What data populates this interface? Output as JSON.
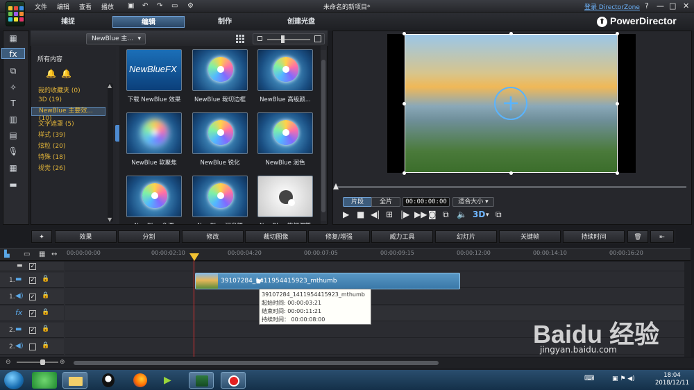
{
  "menu": {
    "file": "文件",
    "edit": "编辑",
    "view": "查看",
    "play": "播放"
  },
  "window_title": "未命名的新项目*",
  "login_link": "登录 DirectorZone",
  "window_buttons": {
    "help": "?",
    "minimize": "—",
    "maximize": "□",
    "close": "✕"
  },
  "modes": [
    {
      "label": "捕捉"
    },
    {
      "label": "编辑"
    },
    {
      "label": "制作"
    },
    {
      "label": "创建光盘"
    }
  ],
  "brand": "PowerDirector",
  "library": {
    "dropdown": "NewBlue 主...",
    "category_header": "所有内容",
    "categories": [
      {
        "label": "我的收藏夹 (0)"
      },
      {
        "label": "3D (19)"
      },
      {
        "label": "NewBlue 主要效... (10)"
      },
      {
        "label": "文字遮罩 (5)"
      },
      {
        "label": "样式 (39)"
      },
      {
        "label": "炫粒 (20)"
      },
      {
        "label": "特殊 (18)"
      },
      {
        "label": "视觉 (26)"
      }
    ],
    "thumbs": [
      {
        "label": "下载 NewBlue 效果",
        "overlay": "NewBlueFX"
      },
      {
        "label": "NewBlue 裁切边框"
      },
      {
        "label": "NewBlue 高级颜..."
      },
      {
        "label": "NewBlue 软聚焦"
      },
      {
        "label": "NewBlue 锐化"
      },
      {
        "label": "NewBlue 润色"
      },
      {
        "label": "NewBlue 色调"
      },
      {
        "label": "NewBlue 闪光耀"
      },
      {
        "label": "NewBlue 旋烟调整"
      }
    ]
  },
  "preview": {
    "mode_clip": "片段",
    "mode_movie": "全片",
    "timecode": "00:00:00:00",
    "fit": "适合大小",
    "threed": "3D"
  },
  "toolbar": [
    "效果",
    "分割",
    "修改",
    "裁切图像",
    "修复/增强",
    "威力工具",
    "幻灯片",
    "关键帧",
    "持续时间"
  ],
  "ruler": [
    "00:00:00:00",
    "00:00:02:10",
    "00:00:04:20",
    "00:00:07:05",
    "00:00:09:15",
    "00:00:12:00",
    "00:00:14:10",
    "00:00:16:20"
  ],
  "tracks": [
    {
      "num": "",
      "checked": true
    },
    {
      "num": "1.",
      "checked": true
    },
    {
      "num": "1.",
      "checked": true
    },
    {
      "num": "",
      "checked": true
    },
    {
      "num": "2.",
      "checked": true
    },
    {
      "num": "2.",
      "checked": false
    }
  ],
  "clip": {
    "label": "39107284_1411954415923_mthumb",
    "tooltip_name": "39107284_1411954415923_mthumb",
    "start": "起始时间: 00:00:03:21",
    "end": "结束时间: 00:00:11:21",
    "duration": "持续时间： 00:00:08:00"
  },
  "taskbar": {
    "time": "18:04",
    "date": "2018/12/11"
  },
  "watermark": {
    "brand": "Baidu 经验",
    "url": "jingyan.baidu.com"
  },
  "colors": {
    "accent": "#5a9bd4",
    "category_text": "#e3b53a",
    "clip": "#4a88b8",
    "playhead": "#e03030"
  }
}
